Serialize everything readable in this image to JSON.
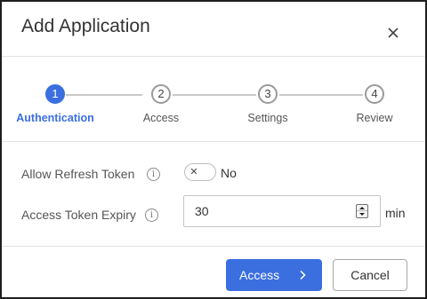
{
  "dialog": {
    "title": "Add Application"
  },
  "stepper": {
    "steps": [
      {
        "number": "1",
        "label": "Authentication",
        "active": true
      },
      {
        "number": "2",
        "label": "Access",
        "active": false
      },
      {
        "number": "3",
        "label": "Settings",
        "active": false
      },
      {
        "number": "4",
        "label": "Review",
        "active": false
      }
    ]
  },
  "form": {
    "refresh_token": {
      "label": "Allow Refresh Token",
      "info_icon": "i",
      "toggle_state": "No",
      "toggle_glyph": "✕"
    },
    "token_expiry": {
      "label": "Access Token Expiry",
      "info_icon": "i",
      "value": "30",
      "unit": "min"
    }
  },
  "footer": {
    "primary_label": "Access",
    "secondary_label": "Cancel"
  },
  "colors": {
    "accent": "#3b6fe0",
    "border": "#e3e3e3",
    "text": "#333333"
  },
  "icons": {
    "close": "close-icon",
    "next": "chevron-right-icon",
    "info": "info-icon",
    "toggle_off": "x-icon",
    "spinner": "spinner-arrows-icon"
  }
}
